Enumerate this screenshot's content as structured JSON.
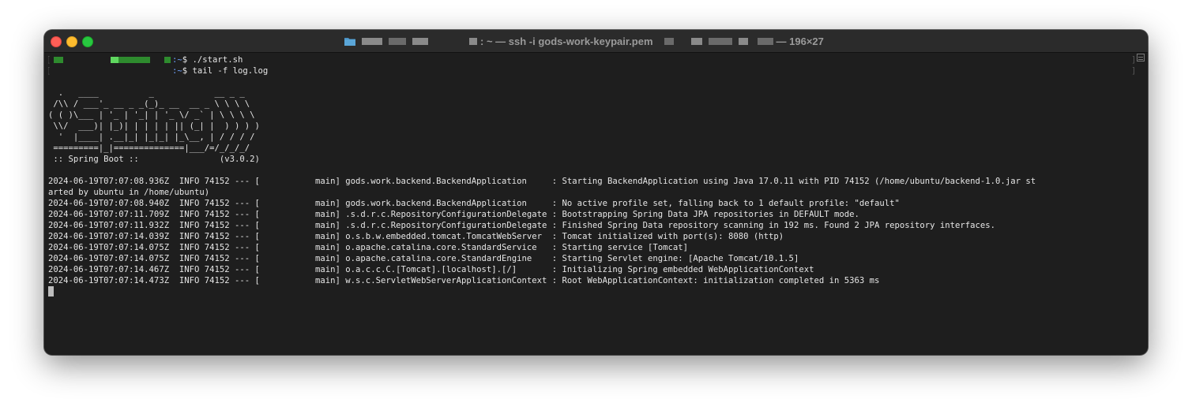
{
  "window": {
    "title_text": ": ~ — ssh -i gods-work-keypair.pem",
    "title_size": "— 196×27"
  },
  "prompts": [
    {
      "suffix": ":~",
      "symbol": "$",
      "command": "./start.sh"
    },
    {
      "suffix": ":~",
      "symbol": "$",
      "command": "tail -f log.log"
    }
  ],
  "banner": [
    "  .   ____          _            __ _ _",
    " /\\\\ / ___'_ __ _ _(_)_ __  __ _ \\ \\ \\ \\",
    "( ( )\\___ | '_ | '_| | '_ \\/ _` | \\ \\ \\ \\",
    " \\\\/  ___)| |_)| | | | | || (_| |  ) ) ) )",
    "  '  |____| .__|_| |_|_| |_\\__, | / / / /",
    " =========|_|==============|___/=/_/_/_/",
    " :: Spring Boot ::                (v3.0.2)"
  ],
  "log_lines": [
    "2024-06-19T07:07:08.936Z  INFO 74152 --- [           main] gods.work.backend.BackendApplication     : Starting BackendApplication using Java 17.0.11 with PID 74152 (/home/ubuntu/backend-1.0.jar st",
    "arted by ubuntu in /home/ubuntu)",
    "2024-06-19T07:07:08.940Z  INFO 74152 --- [           main] gods.work.backend.BackendApplication     : No active profile set, falling back to 1 default profile: \"default\"",
    "2024-06-19T07:07:11.709Z  INFO 74152 --- [           main] .s.d.r.c.RepositoryConfigurationDelegate : Bootstrapping Spring Data JPA repositories in DEFAULT mode.",
    "2024-06-19T07:07:11.932Z  INFO 74152 --- [           main] .s.d.r.c.RepositoryConfigurationDelegate : Finished Spring Data repository scanning in 192 ms. Found 2 JPA repository interfaces.",
    "2024-06-19T07:07:14.039Z  INFO 74152 --- [           main] o.s.b.w.embedded.tomcat.TomcatWebServer  : Tomcat initialized with port(s): 8080 (http)",
    "2024-06-19T07:07:14.075Z  INFO 74152 --- [           main] o.apache.catalina.core.StandardService   : Starting service [Tomcat]",
    "2024-06-19T07:07:14.075Z  INFO 74152 --- [           main] o.apache.catalina.core.StandardEngine    : Starting Servlet engine: [Apache Tomcat/10.1.5]",
    "2024-06-19T07:07:14.467Z  INFO 74152 --- [           main] o.a.c.c.C.[Tomcat].[localhost].[/]       : Initializing Spring embedded WebApplicationContext",
    "2024-06-19T07:07:14.473Z  INFO 74152 --- [           main] w.s.c.ServletWebServerApplicationContext : Root WebApplicationContext: initialization completed in 5363 ms"
  ],
  "colors": {
    "background": "#1e1e1e",
    "titlebar": "#2b2b2b",
    "text": "#e6e6e6",
    "prompt_host": "#5fd75f",
    "prompt_dir": "#6c9ef8"
  },
  "icons": {
    "title_folder": "folder-icon",
    "scroll_marker": "scroll-marker-icon"
  }
}
